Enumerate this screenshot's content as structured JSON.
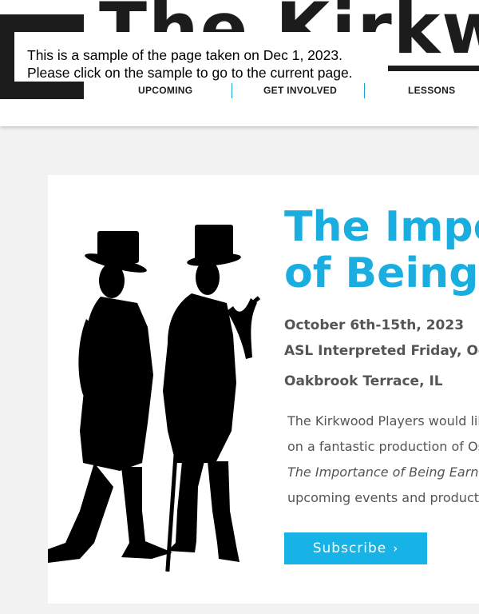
{
  "header": {
    "site_title": "The Kirkwood",
    "sample_note": {
      "line1": "This is a sample of the page taken on Dec 1, 2023.",
      "line2": "Please click on the sample to go to the current page."
    },
    "nav": [
      {
        "label": "UPCOMING"
      },
      {
        "label": "GET INVOLVED"
      },
      {
        "label": "LESSONS"
      }
    ]
  },
  "show": {
    "title_line1": "The Impo",
    "title_line2": "of Being I",
    "dates": "October 6th-15th, 2023",
    "asl": "ASL Interpreted Friday, Octo",
    "location": "Oakbrook Terrace, IL",
    "description": [
      "The Kirkwood Players would lik",
      "on a fantastic production of Os",
      "The Importance of Being Earn",
      "upcoming events and product"
    ],
    "subscribe_label": "Subscribe",
    "subscribe_icon": "chevron-right-icon"
  },
  "colors": {
    "accent": "#1aaee0",
    "button": "#17b2e6",
    "text_gray": "#555555",
    "dark": "#1c1c1c",
    "background": "#f2f2f2"
  }
}
